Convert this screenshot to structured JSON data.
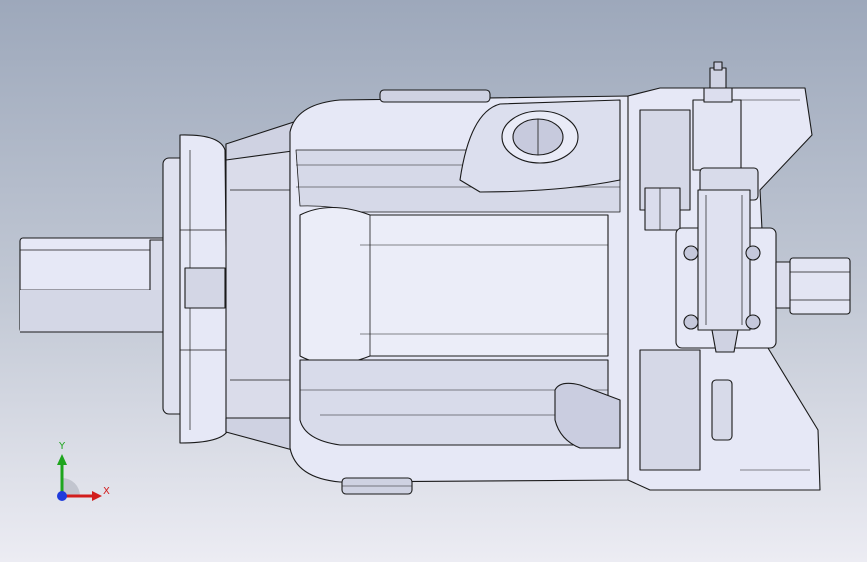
{
  "viewport": {
    "background_top": "#9da8bb",
    "background_bottom": "#ececf3"
  },
  "model": {
    "icon": "hydraulic-pump-icon",
    "body_color": "#e6e8f6",
    "edge_color": "#1a1a1a",
    "shade_color": "#b9bdd0"
  },
  "triad": {
    "y_label": "Y",
    "x_label": "X",
    "y_color": "#1ea51e",
    "x_color": "#d21d1d",
    "origin_color": "#1f3bdc"
  }
}
